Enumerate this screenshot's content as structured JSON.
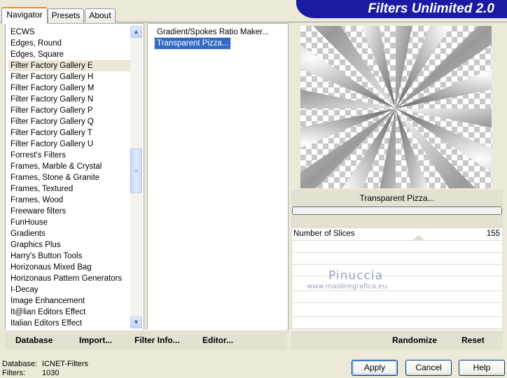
{
  "tabs": [
    "Navigator",
    "Presets",
    "About"
  ],
  "banner_title": "Filters Unlimited 2.0",
  "categories": [
    "ECWS",
    "Edges, Round",
    "Edges, Square",
    "Filter Factory Gallery E",
    "Filter Factory Gallery H",
    "Filter Factory Gallery M",
    "Filter Factory Gallery N",
    "Filter Factory Gallery P",
    "Filter Factory Gallery Q",
    "Filter Factory Gallery T",
    "Filter Factory Gallery U",
    "Forrest's Filters",
    "Frames, Marble & Crystal",
    "Frames, Stone & Granite",
    "Frames, Textured",
    "Frames, Wood",
    "Freeware filters",
    "FunHouse",
    "Gradients",
    "Graphics Plus",
    "Harry's Button Tools",
    "Horizonaus Mixed Bag",
    "Horizonaus Pattern Generators",
    "I-Decay",
    "Image Enhancement",
    "It@lian Editors Effect",
    "Italian Editors Effect"
  ],
  "highlighted_category": "Filter Factory Gallery E",
  "filters": [
    "Gradient/Spokes Ratio Maker...",
    "Transparent Pizza..."
  ],
  "selected_filter": "Transparent Pizza...",
  "preview_caption": "Transparent Pizza...",
  "parameter": {
    "name": "Number of Slices",
    "value": "155"
  },
  "watermark": {
    "name": "Pinuccia",
    "url": "www.maidiregrafica.eu"
  },
  "toolbar": {
    "database": "Database",
    "import": "Import...",
    "filter_info": "Filter Info...",
    "editor": "Editor...",
    "randomize": "Randomize",
    "reset": "Reset"
  },
  "status": {
    "database_label": "Database:",
    "database_value": "ICNET-Filters",
    "filters_label": "Filters:",
    "filters_value": "1030"
  },
  "buttons": {
    "apply": "Apply",
    "cancel": "Cancel",
    "help": "Help"
  },
  "icons": {
    "scroll_up": "chevron-up-icon",
    "scroll_down": "chevron-down-icon",
    "scroll_grip": "grip-icon"
  },
  "colors": {
    "banner": "#1a1aa3",
    "selection": "#316ac5",
    "tab_accent": "#e68b2c",
    "window": "#ece9d8"
  }
}
